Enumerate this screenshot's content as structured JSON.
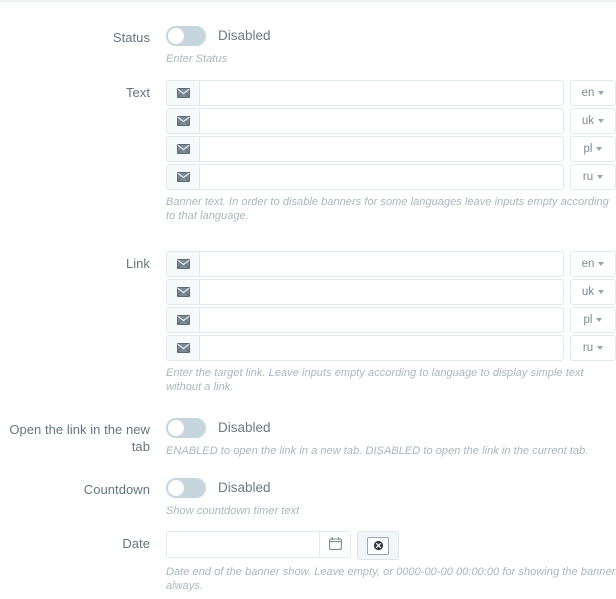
{
  "form": {
    "fields": [
      {
        "key": "status",
        "label": "Status",
        "type": "toggle",
        "toggle_state": "Disabled",
        "help": "Enter Status"
      },
      {
        "key": "text",
        "label": "Text",
        "type": "multilang",
        "icon": "envelope-icon",
        "rows": [
          {
            "lang": "en",
            "value": "",
            "placeholder": ""
          },
          {
            "lang": "uk",
            "value": "",
            "placeholder": ""
          },
          {
            "lang": "pl",
            "value": "",
            "placeholder": ""
          },
          {
            "lang": "ru",
            "value": "",
            "placeholder": ""
          }
        ],
        "help": "Banner text. In order to disable banners for some languages leave inputs empty according to that language."
      },
      {
        "key": "link",
        "label": "Link",
        "type": "multilang",
        "icon": "envelope-icon",
        "rows": [
          {
            "lang": "en",
            "value": "",
            "placeholder": ""
          },
          {
            "lang": "uk",
            "value": "",
            "placeholder": ""
          },
          {
            "lang": "pl",
            "value": "",
            "placeholder": ""
          },
          {
            "lang": "ru",
            "value": "",
            "placeholder": ""
          }
        ],
        "help": "Enter the target link. Leave inputs empty according to language to display simple text without a link."
      },
      {
        "key": "new_tab",
        "label": "Open the link in the new tab",
        "type": "toggle",
        "toggle_state": "Disabled",
        "help": "ENABLED to open the link in a new tab. DISABLED to open the link in the current tab."
      },
      {
        "key": "countdown",
        "label": "Countdown",
        "type": "toggle",
        "toggle_state": "Disabled",
        "help": "Show countdown timer text"
      },
      {
        "key": "date",
        "label": "Date",
        "type": "date",
        "value": "",
        "placeholder": "",
        "calendar_icon": "calendar-icon",
        "clear_icon": "clear-circle-icon",
        "help": "Date end of the banner show. Leave empty, or 0000-00-00 00:00:00 for showing the banner always."
      }
    ]
  },
  "colors": {
    "toggle_off_track": "#c7d6dd",
    "border": "#e3eaee",
    "label_text": "#64757e",
    "help_text": "#a9b6bd",
    "addon_bg": "#f7fafb"
  }
}
